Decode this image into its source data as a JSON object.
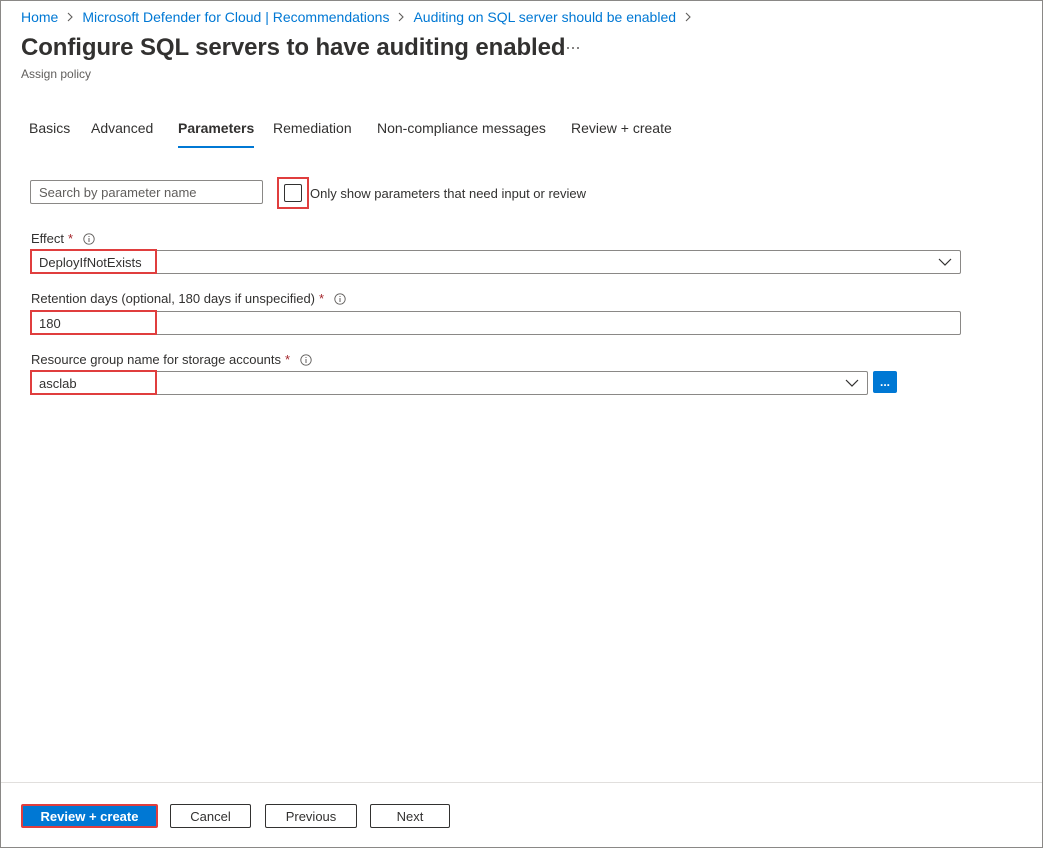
{
  "breadcrumb": [
    {
      "label": "Home"
    },
    {
      "label": "Microsoft Defender for Cloud | Recommendations"
    },
    {
      "label": "Auditing on SQL server should be enabled"
    }
  ],
  "header": {
    "title": "Configure SQL servers to have auditing enabled",
    "subtitle": "Assign policy"
  },
  "tabs": [
    {
      "label": "Basics",
      "active": false
    },
    {
      "label": "Advanced",
      "active": false
    },
    {
      "label": "Parameters",
      "active": true
    },
    {
      "label": "Remediation",
      "active": false
    },
    {
      "label": "Non-compliance messages",
      "active": false
    },
    {
      "label": "Review + create",
      "active": false
    }
  ],
  "filter": {
    "search_placeholder": "Search by parameter name",
    "checkbox_label": "Only show parameters that need input or review",
    "checked": false
  },
  "fields": {
    "effect": {
      "label": "Effect",
      "value": "DeployIfNotExists"
    },
    "retention": {
      "label": "Retention days (optional, 180 days if unspecified)",
      "value": "180"
    },
    "resource_group": {
      "label": "Resource group name for storage accounts",
      "value": "asclab",
      "browse_label": "..."
    }
  },
  "footer": {
    "review_create": "Review + create",
    "cancel": "Cancel",
    "previous": "Previous",
    "next": "Next"
  },
  "colors": {
    "accent": "#0078d4",
    "highlight": "#e03e3e",
    "required": "#a4262c"
  },
  "icons": [
    "chevron-right-icon",
    "more-icon",
    "info-icon",
    "chevron-down-icon"
  ]
}
